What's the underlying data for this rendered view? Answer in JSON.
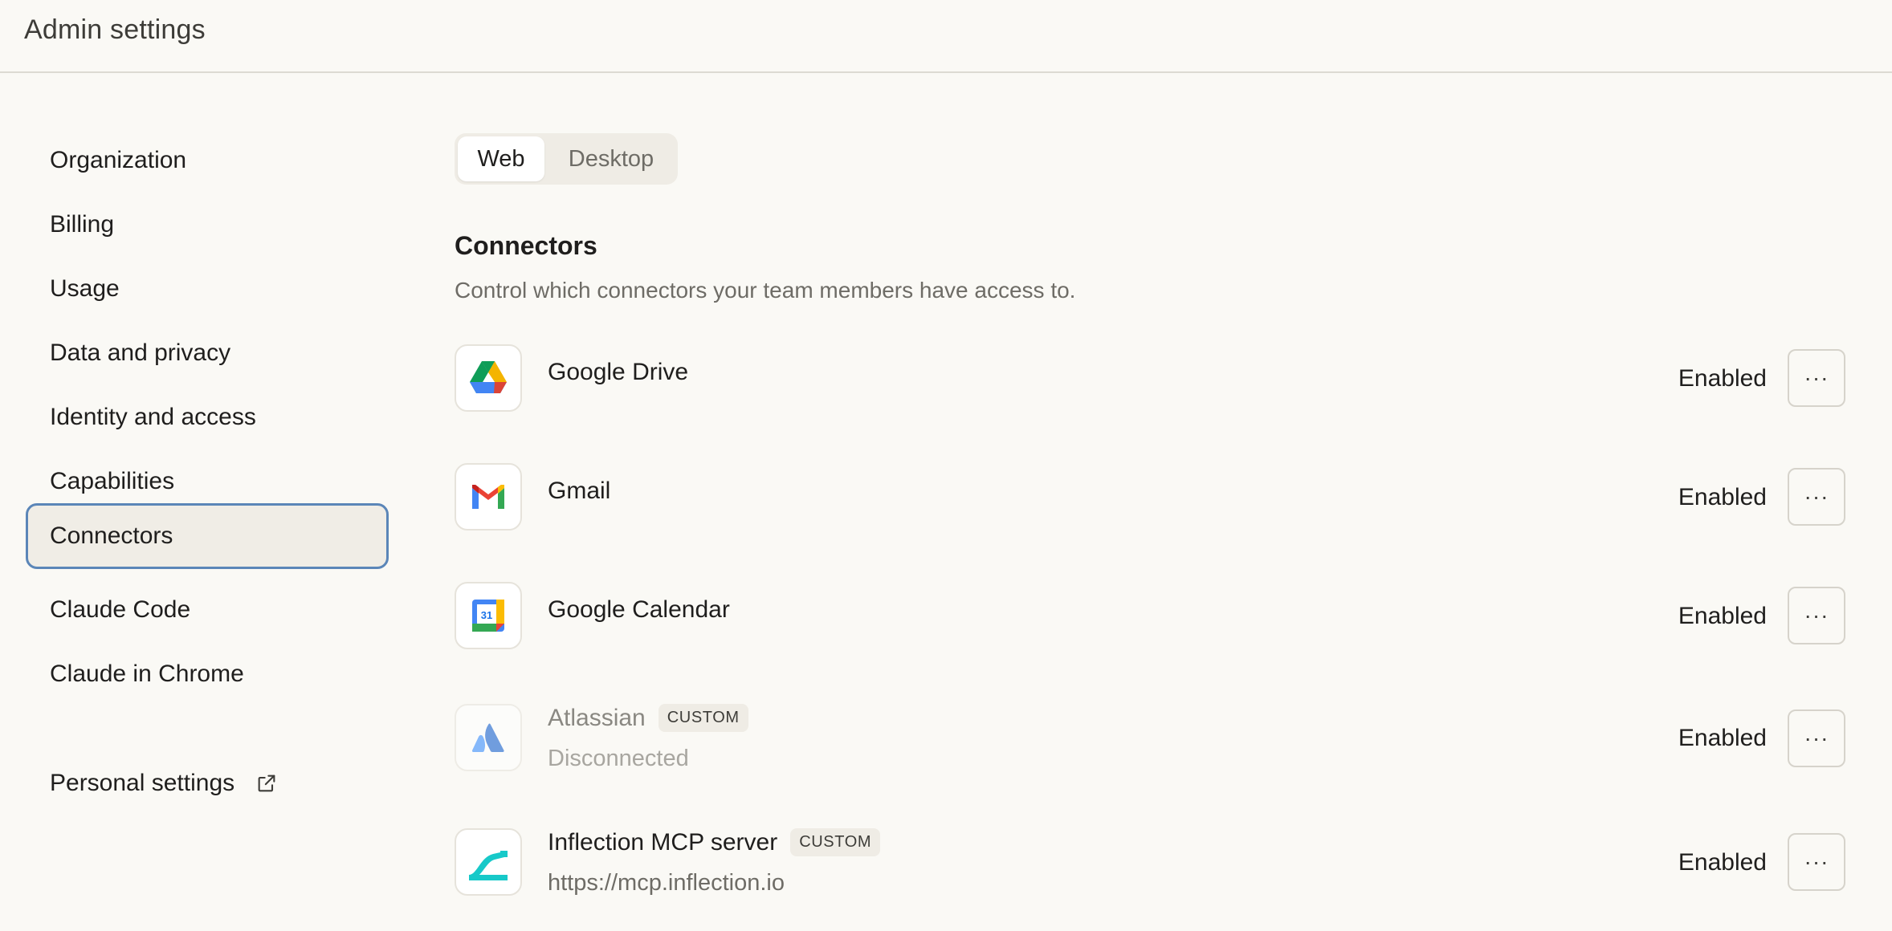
{
  "header": {
    "title": "Admin settings"
  },
  "sidebar": {
    "items": [
      {
        "label": "Organization"
      },
      {
        "label": "Billing"
      },
      {
        "label": "Usage"
      },
      {
        "label": "Data and privacy"
      },
      {
        "label": "Identity and access"
      },
      {
        "label": "Capabilities"
      },
      {
        "label": "Connectors",
        "active": true
      },
      {
        "label": "Claude Code"
      },
      {
        "label": "Claude in Chrome"
      }
    ],
    "personal": {
      "label": "Personal settings",
      "icon": "external-link-icon"
    }
  },
  "tabs": {
    "web": "Web",
    "desktop": "Desktop",
    "selected": "Web"
  },
  "section": {
    "title": "Connectors",
    "description": "Control which connectors your team members have access to."
  },
  "connectors": [
    {
      "name": "Google Drive",
      "status": "Enabled",
      "icon": "google-drive-icon"
    },
    {
      "name": "Gmail",
      "status": "Enabled",
      "icon": "gmail-icon"
    },
    {
      "name": "Google Calendar",
      "status": "Enabled",
      "icon": "google-calendar-icon",
      "calendar_day": "31"
    },
    {
      "name": "Atlassian",
      "badge": "CUSTOM",
      "subtitle": "Disconnected",
      "status": "Enabled",
      "icon": "atlassian-icon"
    },
    {
      "name": "Inflection MCP server",
      "badge": "CUSTOM",
      "subtitle": "https://mcp.inflection.io",
      "status": "Enabled",
      "icon": "inflection-icon"
    }
  ],
  "more_label": "···",
  "colors": {
    "background": "#faf9f5",
    "active_border": "#5b86b8",
    "active_fill": "#f0ede6",
    "inflection_teal": "#17c9c9"
  }
}
